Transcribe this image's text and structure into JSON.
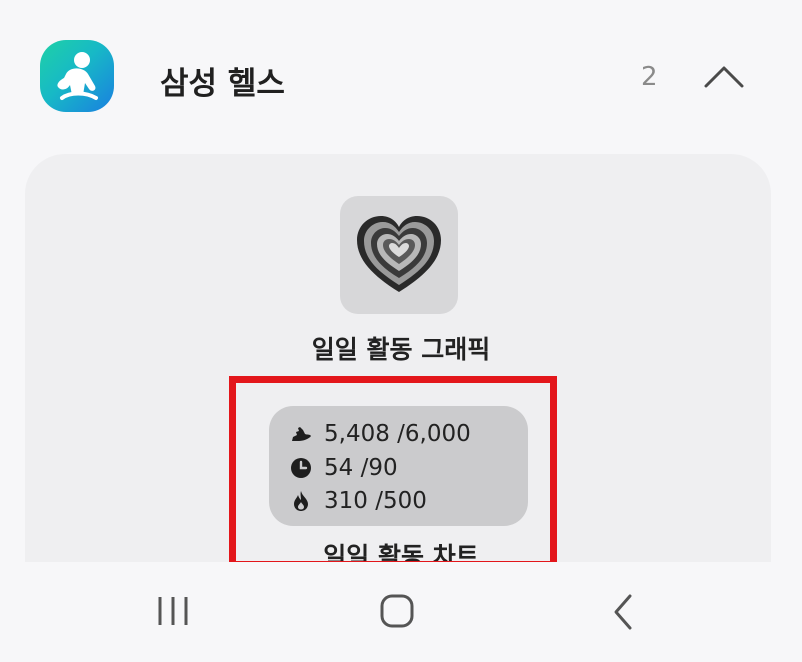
{
  "header": {
    "app_name": "삼성 헬스",
    "count": "2",
    "icon": "samsung-health-icon",
    "collapse_icon": "chevron-up-icon"
  },
  "widget": {
    "title": "일일 활동 그래픽",
    "thumbnail_icon": "heart-rings-icon"
  },
  "preview": {
    "stats": [
      {
        "icon": "steps-icon",
        "text": "5,408 /6,000"
      },
      {
        "icon": "clock-icon",
        "text": "54 /90"
      },
      {
        "icon": "flame-icon",
        "text": "310 /500"
      }
    ],
    "next_title": "일일 활동 차트"
  },
  "navbar": {
    "recents_icon": "recents-icon",
    "home_icon": "home-icon",
    "back_icon": "back-icon"
  },
  "colors": {
    "highlight": "#e3161b",
    "card_bg": "#efeff1",
    "preview_bg": "#cbcbcd"
  }
}
